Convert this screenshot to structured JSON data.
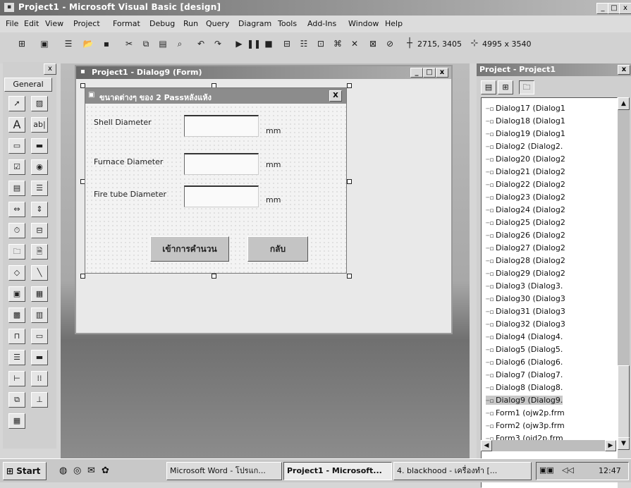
{
  "app": {
    "title": "Project1 - Microsoft Visual Basic [design]",
    "min": "_",
    "max": "□",
    "close": "x"
  },
  "menu": [
    "File",
    "Edit",
    "View",
    "Project",
    "Format",
    "Debug",
    "Run",
    "Query",
    "Diagram",
    "Tools",
    "Add-Ins",
    "Window",
    "Help"
  ],
  "toolbar": {
    "position": "2715, 3405",
    "size": "4995 x 3540"
  },
  "toolbox": {
    "title": "General",
    "close": "x"
  },
  "designer": {
    "title": "Project1 - Dialog9 (Form)"
  },
  "dialog": {
    "title": "ขนาดต่างๆ ของ 2 Passหลังแห้ง",
    "close": "X",
    "fields": [
      {
        "label": "Shell Diameter",
        "unit": "mm"
      },
      {
        "label": "Furnace Diameter",
        "unit": "mm"
      },
      {
        "label": "Fire tube Diameter",
        "unit": "mm"
      }
    ],
    "calc_button": "เข้าการคำนวน",
    "back_button": "กลับ"
  },
  "project": {
    "title": "Project - Project1",
    "close": "x",
    "items": [
      "Dialog17 (Dialog1",
      "Dialog18 (Dialog1",
      "Dialog19 (Dialog1",
      "Dialog2 (Dialog2.",
      "Dialog20 (Dialog2",
      "Dialog21 (Dialog2",
      "Dialog22 (Dialog2",
      "Dialog23 (Dialog2",
      "Dialog24 (Dialog2",
      "Dialog25 (Dialog2",
      "Dialog26 (Dialog2",
      "Dialog27 (Dialog2",
      "Dialog28 (Dialog2",
      "Dialog29 (Dialog2",
      "Dialog3 (Dialog3.",
      "Dialog30 (Dialog3",
      "Dialog31 (Dialog3",
      "Dialog32 (Dialog3",
      "Dialog4 (Dialog4.",
      "Dialog5 (Dialog5.",
      "Dialog6 (Dialog6.",
      "Dialog7 (Dialog7.",
      "Dialog8 (Dialog8.",
      "Dialog9 (Dialog9.",
      "Form1 (ojw2p.frm",
      "Form2 (ojw3p.frm",
      "Form3 (ojd2p.frm"
    ]
  },
  "taskbar": {
    "start": "Start",
    "tasks": [
      "Microsoft Word - โปรแก...",
      "Project1 - Microsoft...",
      "4. blackhood - เครื่องทำ [..."
    ],
    "clock": "12:47"
  }
}
